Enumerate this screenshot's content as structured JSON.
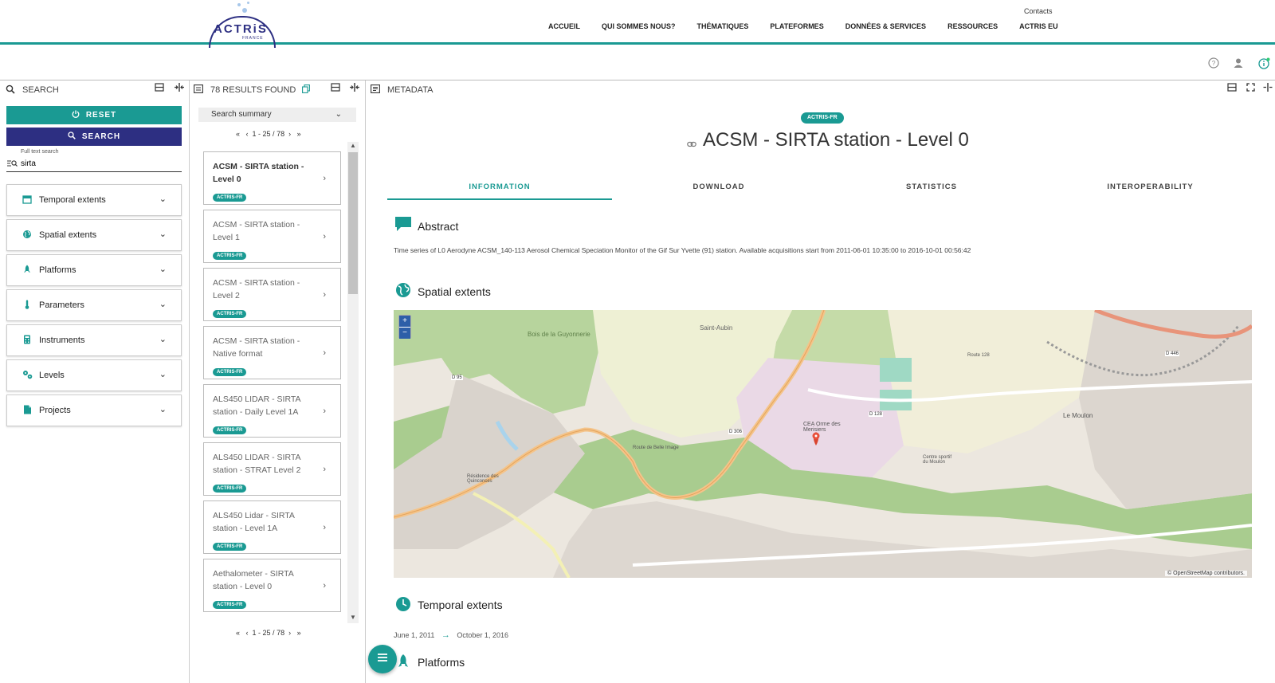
{
  "brand": {
    "name": "ACTRiS",
    "sub": "FRANCE"
  },
  "nav": {
    "contacts": "Contacts",
    "links": [
      "ACCUEIL",
      "QUI SOMMES NOUS?",
      "THÉMATIQUES",
      "PLATEFORMES",
      "DONNÉES & SERVICES",
      "RESSOURCES",
      "ACTRIS EU"
    ]
  },
  "panels": {
    "search": "SEARCH",
    "results": "78 RESULTS FOUND",
    "metadata": "METADATA"
  },
  "search": {
    "reset": "RESET",
    "search": "SEARCH",
    "fulltext_label": "Full text search",
    "fulltext_value": "sirta",
    "filters": [
      "Temporal extents",
      "Spatial extents",
      "Platforms",
      "Parameters",
      "Instruments",
      "Levels",
      "Projects"
    ]
  },
  "results": {
    "summary": "Search summary",
    "pager": "1 - 25 / 78",
    "tag": "ACTRIS-FR",
    "items": [
      "ACSM - SIRTA station - Level 0",
      "ACSM - SIRTA station - Level 1",
      "ACSM - SIRTA station - Level 2",
      "ACSM - SIRTA station - Native format",
      "ALS450 LIDAR - SIRTA station - Daily Level 1A",
      "ALS450 LIDAR - SIRTA station - STRAT Level 2",
      "ALS450 Lidar - SIRTA station - Level 1A",
      "Aethalometer - SIRTA station - Level 0"
    ]
  },
  "metadata": {
    "badge": "ACTRIS-FR",
    "title": "ACSM - SIRTA station - Level 0",
    "tabs": [
      "INFORMATION",
      "DOWNLOAD",
      "STATISTICS",
      "INTEROPERABILITY"
    ],
    "abstract_title": "Abstract",
    "abstract": "Time series of L0 Aerodyne ACSM_140-113 Aerosol Chemical Speciation Monitor of the Gif Sur Yvette (91) station. Available acquisitions start from 2011-06-01 10:35:00 to 2016-10-01 00:56:42",
    "spatial_title": "Spatial extents",
    "map_labels": {
      "bois": "Bois de la Guyonnerie",
      "saint_aubin": "Saint-Aubin",
      "cea": "CEA Orme des Merisiers",
      "moulon": "Le Moulon",
      "route": "Route de Belle Image",
      "d95": "D 95",
      "d306": "D 306",
      "d128": "D 128",
      "d446": "D 446",
      "route128": "Route 128",
      "residence": "Résidence des Quinconces",
      "centre": "Centre sportif du Moulon"
    },
    "map_attribution": "© OpenStreetMap contributors.",
    "temporal_title": "Temporal extents",
    "temporal_start": "June 1, 2011",
    "temporal_end": "October 1, 2016",
    "platforms_title": "Platforms"
  },
  "colors": {
    "teal": "#1a9a93",
    "navy": "#2d2f82"
  }
}
